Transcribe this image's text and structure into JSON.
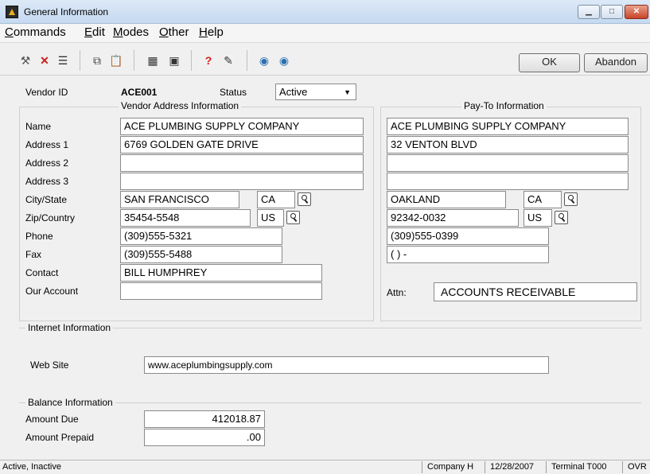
{
  "window": {
    "title": "General Information",
    "icon": "app-icon"
  },
  "menu": [
    "Commands",
    "Edit",
    "Modes",
    "Other",
    "Help"
  ],
  "toolbar": {
    "icons": [
      "tools-icon",
      "delete-icon",
      "list-icon",
      "copy-icon",
      "paste-icon",
      "calculator-icon",
      "calendar-icon",
      "help-icon",
      "edit-icon",
      "globe-back-icon",
      "globe-forward-icon"
    ],
    "ok_label": "OK",
    "abandon_label": "Abandon"
  },
  "vendor": {
    "id_label": "Vendor ID",
    "id_value": "ACE001",
    "status_label": "Status",
    "status_value": "Active"
  },
  "vendor_address": {
    "title": "Vendor Address Information",
    "labels": {
      "name": "Name",
      "address1": "Address 1",
      "address2": "Address 2",
      "address3": "Address 3",
      "city_state": "City/State",
      "zip_country": "Zip/Country",
      "phone": "Phone",
      "fax": "Fax",
      "contact": "Contact",
      "our_account": "Our Account"
    },
    "values": {
      "name": "ACE PLUMBING SUPPLY COMPANY",
      "address1": "6769 GOLDEN GATE DRIVE",
      "address2": "",
      "address3": "",
      "city": "SAN FRANCISCO",
      "state": "CA",
      "zip": "35454-5548",
      "country": "US",
      "phone": "(309)555-5321",
      "fax": "(309)555-5488",
      "contact": "BILL HUMPHREY",
      "our_account": ""
    }
  },
  "pay_to": {
    "title": "Pay-To Information",
    "values": {
      "name": "ACE PLUMBING SUPPLY COMPANY",
      "address1": "32 VENTON BLVD",
      "address2": "",
      "address3": "",
      "city": "OAKLAND",
      "state": "CA",
      "zip": "92342-0032",
      "country": "US",
      "phone": "(309)555-0399",
      "fax": "(   )   -"
    },
    "attn_label": "Attn:",
    "attn_value": "ACCOUNTS RECEIVABLE"
  },
  "internet": {
    "title": "Internet Information",
    "website_label": "Web Site",
    "website_value": "www.aceplumbingsupply.com"
  },
  "balance": {
    "title": "Balance Information",
    "amount_due_label": "Amount Due",
    "amount_due_value": "412018.87",
    "amount_prepaid_label": "Amount Prepaid",
    "amount_prepaid_value": ".00"
  },
  "statusbar": {
    "hint": "Active, Inactive",
    "company": "Company H",
    "date": "12/28/2007",
    "terminal": "Terminal T000",
    "mode": "OVR"
  }
}
